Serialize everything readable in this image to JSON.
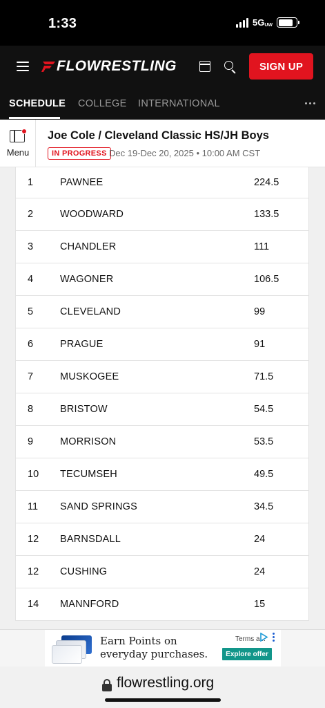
{
  "status_bar": {
    "time": "1:33",
    "network": "5G",
    "network_suffix": "UW"
  },
  "header": {
    "logo_text": "FLOWRESTLING",
    "signup_label": "SIGN UP",
    "brand_color": "#e1141f"
  },
  "nav": {
    "tabs": [
      {
        "label": "SCHEDULE",
        "active": true
      },
      {
        "label": "COLLEGE",
        "active": false
      },
      {
        "label": "INTERNATIONAL",
        "active": false
      }
    ]
  },
  "event": {
    "menu_label": "Menu",
    "title": "Joe Cole / Cleveland Classic HS/JH Boys",
    "status": "IN PROGRESS",
    "meta": "Dec 19-Dec 20, 2025 • 10:00 AM CST"
  },
  "standings": [
    {
      "rank": "1",
      "team": "PAWNEE",
      "score": "224.5"
    },
    {
      "rank": "2",
      "team": "WOODWARD",
      "score": "133.5"
    },
    {
      "rank": "3",
      "team": "CHANDLER",
      "score": "111"
    },
    {
      "rank": "4",
      "team": "WAGONER",
      "score": "106.5"
    },
    {
      "rank": "5",
      "team": "CLEVELAND",
      "score": "99"
    },
    {
      "rank": "6",
      "team": "PRAGUE",
      "score": "91"
    },
    {
      "rank": "7",
      "team": "MUSKOGEE",
      "score": "71.5"
    },
    {
      "rank": "8",
      "team": "BRISTOW",
      "score": "54.5"
    },
    {
      "rank": "9",
      "team": "MORRISON",
      "score": "53.5"
    },
    {
      "rank": "10",
      "team": "TECUMSEH",
      "score": "49.5"
    },
    {
      "rank": "11",
      "team": "SAND SPRINGS",
      "score": "34.5"
    },
    {
      "rank": "12",
      "team": "BARNSDALL",
      "score": "24"
    },
    {
      "rank": "12",
      "team": "CUSHING",
      "score": "24"
    },
    {
      "rank": "14",
      "team": "MANNFORD",
      "score": "15"
    }
  ],
  "ad": {
    "line1": "Earn Points on",
    "line2": "everyday purchases.",
    "terms": "Terms a...",
    "cta": "Explore offer"
  },
  "browser": {
    "url": "flowrestling.org"
  }
}
